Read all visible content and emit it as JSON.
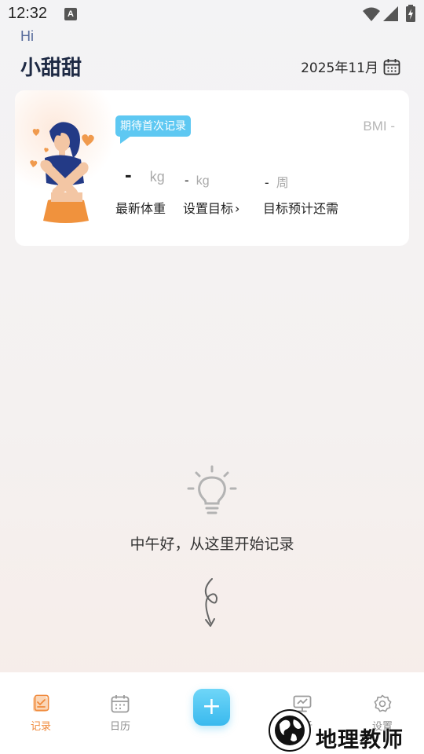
{
  "status_bar": {
    "time": "12:32",
    "notification_letter": "A",
    "icons": [
      "wifi-icon",
      "signal-icon",
      "battery-charging-icon"
    ]
  },
  "header": {
    "greeting": "Hi",
    "username": "小甜甜",
    "date": "2025年11月"
  },
  "card": {
    "bubble": "期待首次记录",
    "bmi": "BMI -",
    "latest_weight": {
      "value": "-",
      "unit": "kg",
      "label": "最新体重"
    },
    "target": {
      "value": "-",
      "unit": "kg",
      "label": "设置目标",
      "chevron": "›"
    },
    "remaining": {
      "value": "-",
      "unit": "周",
      "label": "目标预计还需"
    }
  },
  "empty_state": {
    "message": "中午好，从这里开始记录"
  },
  "bottom_nav": {
    "items": [
      {
        "label": "记录",
        "icon": "record-icon",
        "active": true
      },
      {
        "label": "日历",
        "icon": "calendar-icon",
        "active": false
      },
      {
        "label": "+",
        "icon": "plus-icon",
        "active": false
      },
      {
        "label": "分析",
        "icon": "analysis-icon",
        "active": false
      },
      {
        "label": "设置",
        "icon": "settings-icon",
        "active": false
      }
    ]
  },
  "watermark": {
    "text": "地理教师",
    "ring_text": "NET JS..."
  },
  "colors": {
    "accent_blue": "#5ec8f2",
    "accent_orange": "#f08a3c",
    "title_navy": "#1e2a44"
  }
}
